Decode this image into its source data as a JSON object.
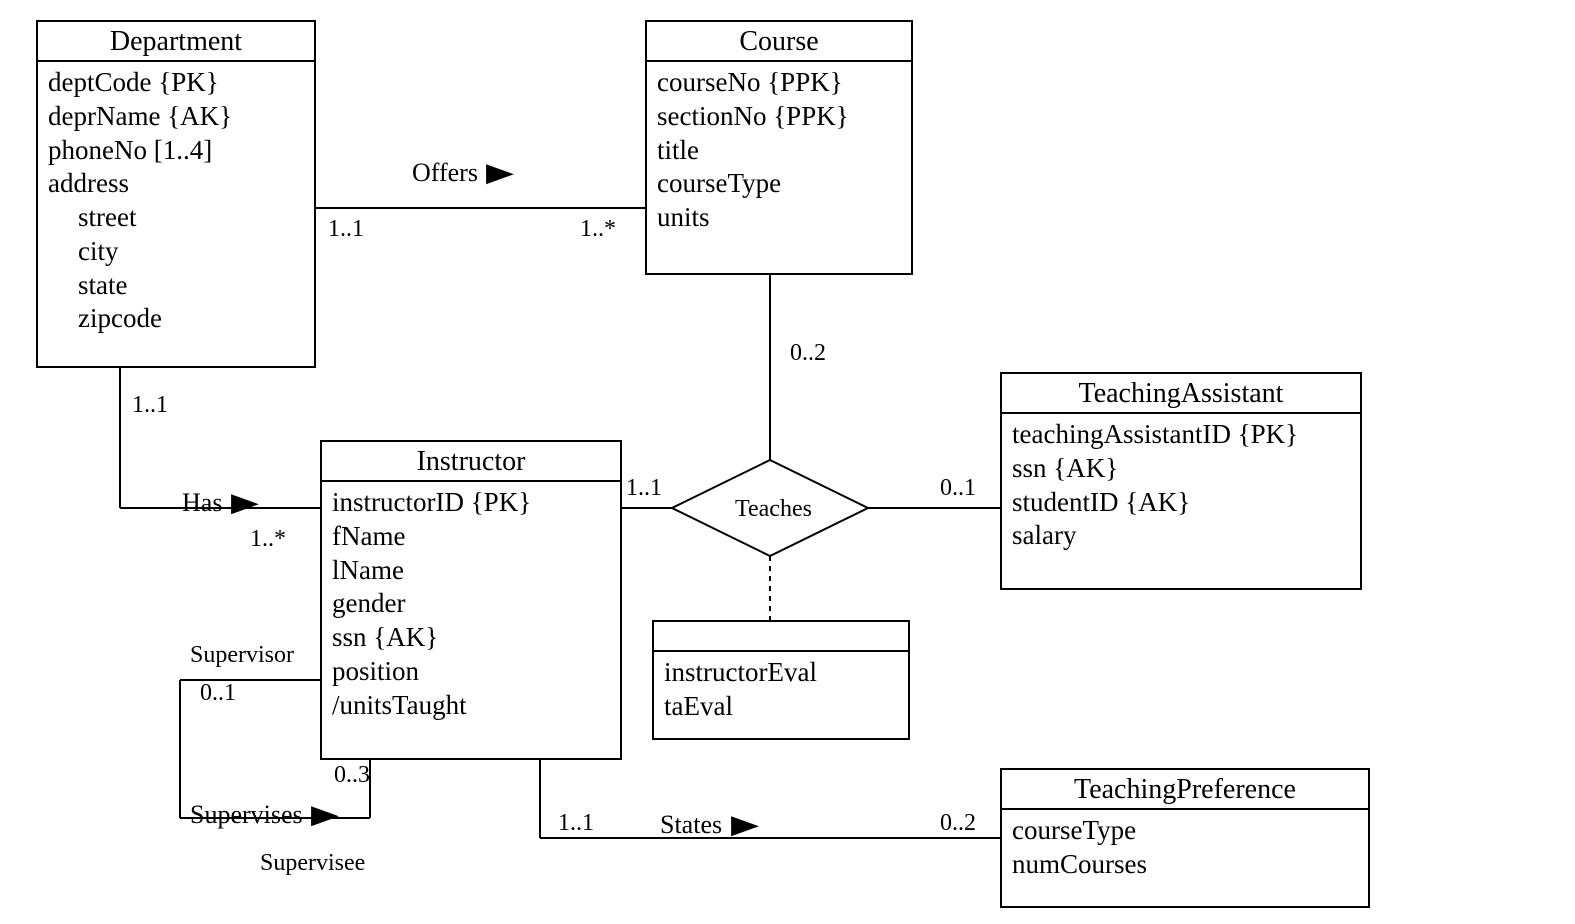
{
  "entities": {
    "department": {
      "name": "Department",
      "attrs": [
        "deptCode {PK}",
        "deprName {AK}",
        "phoneNo [1..4]",
        "address",
        "street",
        "city",
        "state",
        "zipcode"
      ]
    },
    "course": {
      "name": "Course",
      "attrs": [
        "courseNo {PPK}",
        "sectionNo {PPK}",
        "title",
        "courseType",
        "units"
      ]
    },
    "instructor": {
      "name": "Instructor",
      "attrs": [
        "instructorID {PK}",
        "fName",
        "lName",
        "gender",
        "ssn {AK}",
        "position",
        "/unitsTaught"
      ]
    },
    "teachingAssistant": {
      "name": "TeachingAssistant",
      "attrs": [
        "teachingAssistantID {PK}",
        "ssn {AK}",
        "studentID {AK}",
        "salary"
      ]
    },
    "teachesAssoc": {
      "attrs": [
        "instructorEval",
        "taEval"
      ]
    },
    "teachingPreference": {
      "name": "TeachingPreference",
      "attrs": [
        "courseType",
        "numCourses"
      ]
    }
  },
  "relationships": {
    "offers": {
      "name": "Offers",
      "mult": {
        "department": "1..1",
        "course": "1..*"
      }
    },
    "has": {
      "name": "Has",
      "mult": {
        "department": "1..1",
        "instructor": "1..*"
      }
    },
    "teaches": {
      "name": "Teaches",
      "mult": {
        "course": "0..2",
        "instructor": "1..1",
        "teachingAssistant": "0..1"
      }
    },
    "supervises": {
      "name": "Supervises",
      "roles": {
        "supervisor": "Supervisor",
        "supervisee": "Supervisee"
      },
      "mult": {
        "supervisor": "0..1",
        "supervisee": "0..3"
      }
    },
    "states": {
      "name": "States",
      "mult": {
        "instructor": "1..1",
        "teachingPreference": "0..2"
      }
    }
  }
}
